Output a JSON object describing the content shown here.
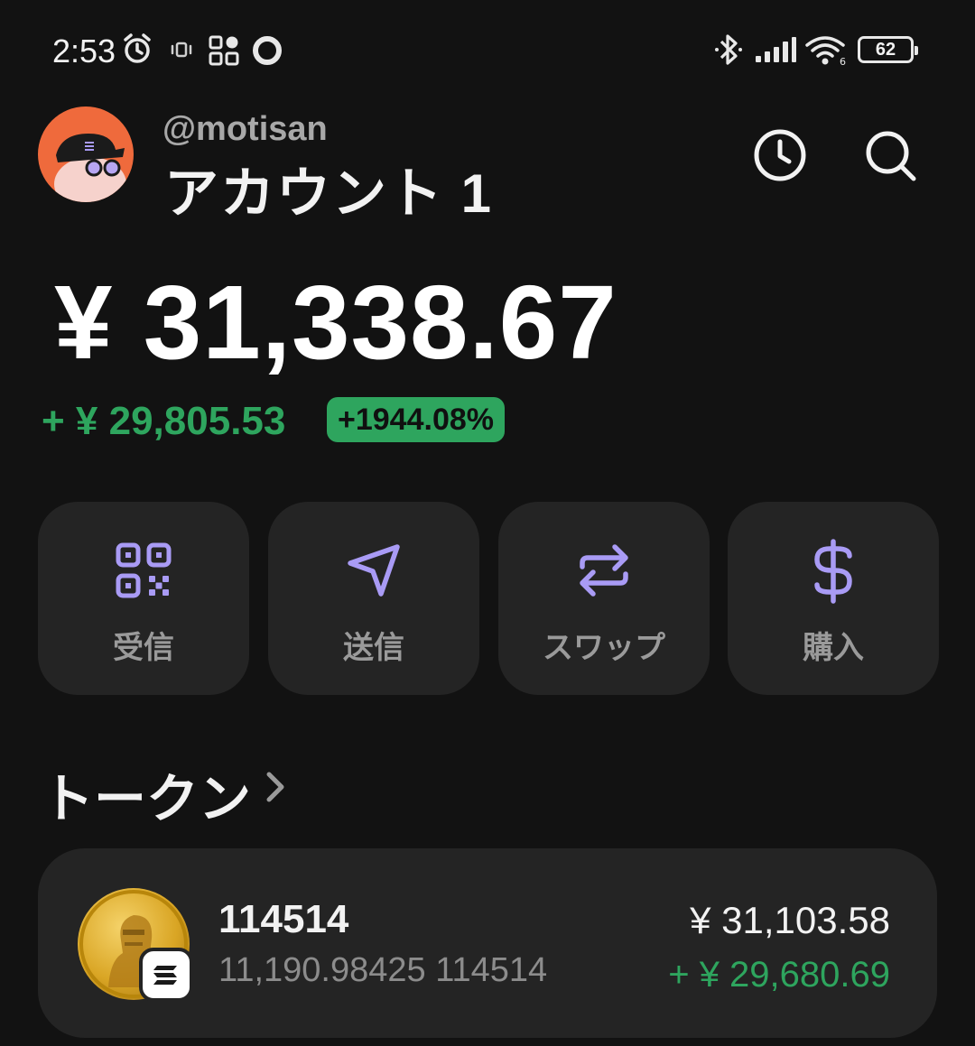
{
  "status_bar": {
    "time": "2:53",
    "battery": "62"
  },
  "header": {
    "handle": "@motisan",
    "account_name": "アカウント 1"
  },
  "balance": {
    "total": "¥ 31,338.67",
    "change": "+ ¥ 29,805.53",
    "change_percent": "+1944.08%"
  },
  "actions": [
    {
      "label": "受信",
      "icon": "qr-code-icon"
    },
    {
      "label": "送信",
      "icon": "send-icon"
    },
    {
      "label": "スワップ",
      "icon": "swap-icon"
    },
    {
      "label": "購入",
      "icon": "dollar-icon"
    }
  ],
  "tokens_section": {
    "title": "トークン"
  },
  "tokens": [
    {
      "name": "114514",
      "amount": "11,190.98425 114514",
      "value": "¥ 31,103.58",
      "change": "+ ¥ 29,680.69"
    }
  ],
  "colors": {
    "background": "#121212",
    "card": "#242424",
    "accent": "#a99bf5",
    "positive": "#2ea55e"
  }
}
